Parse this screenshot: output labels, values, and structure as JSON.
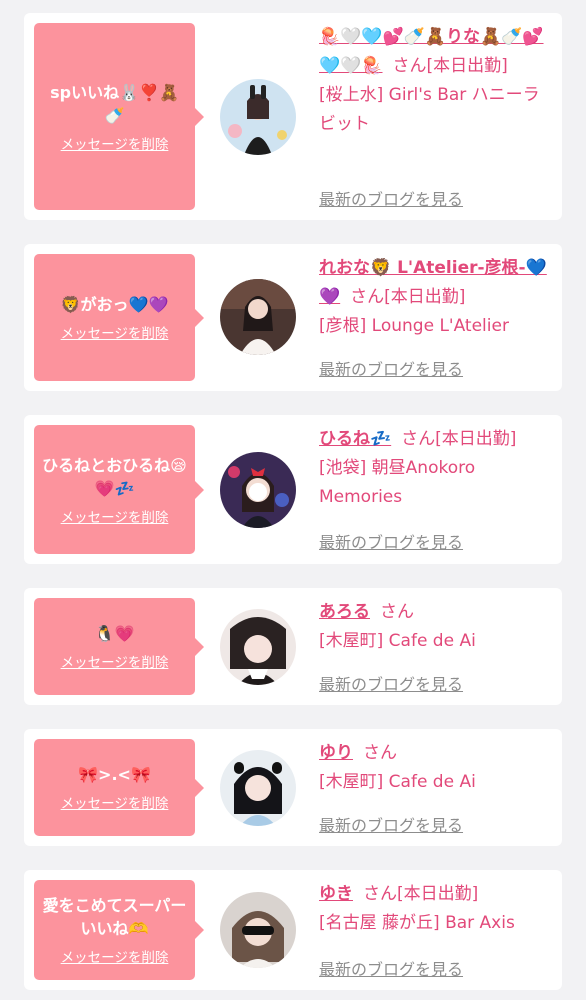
{
  "messages": [
    {
      "bubble_text": "spいいね🐰❣️🧸🍼",
      "delete_label": "メッセージを削除",
      "name": "🪼🤍🩵💕🍼🧸りな🧸🍼💕🩵🤍🪼",
      "honorific": "さん",
      "status": "[本日出勤]",
      "shop": "[桜上水] Girl's Bar ハニーラビット",
      "blog_label": "最新のブログを見る"
    },
    {
      "bubble_text": "🦁がおっ💙💜",
      "delete_label": "メッセージを削除",
      "name": "れおな🦁 L'Atelier-彦根-💙💜",
      "honorific": "さん",
      "status": "[本日出勤]",
      "shop": "[彦根] Lounge L'Atelier",
      "blog_label": "最新のブログを見る"
    },
    {
      "bubble_text": "ひるねとおひるね😪💗💤",
      "delete_label": "メッセージを削除",
      "name": "ひるね💤",
      "honorific": "さん",
      "status": "[本日出勤]",
      "shop": "[池袋] 朝昼Anokoro Memories",
      "blog_label": "最新のブログを見る"
    },
    {
      "bubble_text": "🐧💗",
      "delete_label": "メッセージを削除",
      "name": "あろる",
      "honorific": "さん",
      "status": "",
      "shop": "[木屋町] Cafe de Ai",
      "blog_label": "最新のブログを見る"
    },
    {
      "bubble_text": "🎀>.<🎀",
      "delete_label": "メッセージを削除",
      "name": "ゆり",
      "honorific": "さん",
      "status": "",
      "shop": "[木屋町] Cafe de Ai",
      "blog_label": "最新のブログを見る"
    },
    {
      "bubble_text": "愛をこめてスーパーいいね🫶",
      "delete_label": "メッセージを削除",
      "name": "ゆき",
      "honorific": "さん",
      "status": "[本日出勤]",
      "shop": "[名古屋 藤が丘] Bar Axis",
      "blog_label": "最新のブログを見る"
    }
  ],
  "colors": {
    "bubble": "#fc939d",
    "accent": "#e2497a",
    "muted": "#8d8d8d",
    "background": "#f2f2f4"
  }
}
